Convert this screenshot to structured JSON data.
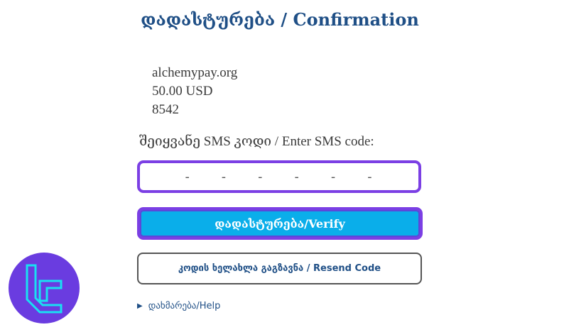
{
  "page": {
    "title": "დადასტურება / Confirmation"
  },
  "transaction": {
    "merchant": "alchemypay.org",
    "amount": "50.00 USD",
    "card_last4": "8542"
  },
  "sms": {
    "prompt": "შეიყვანე SMS კოდი / Enter SMS code:",
    "placeholder": "-   -   -   -   -   -",
    "value": ""
  },
  "buttons": {
    "verify_label": "დადასტურება/Verify",
    "resend_label": "კოდის ხელახლა გაგზავნა / Resend Code"
  },
  "help": {
    "label": "დახმარება/Help",
    "icon": "triangle-right-icon"
  },
  "logo": {
    "icon": "brand-logo-icon"
  },
  "colors": {
    "title": "#1f4f86",
    "accent_border": "#7b3fe4",
    "verify_bg": "#0aaeea",
    "logo_bg": "#6a3ce0",
    "logo_stroke": "#19e0f2"
  }
}
